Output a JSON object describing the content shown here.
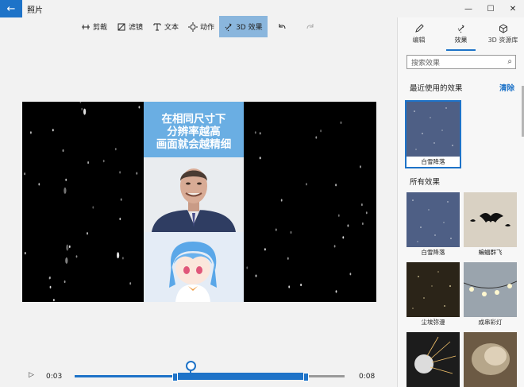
{
  "window": {
    "title": "照片",
    "minimize": "—",
    "maximize": "☐",
    "close": "✕"
  },
  "toolbar": {
    "items": [
      {
        "label": "剪裁",
        "icon": "trim-icon"
      },
      {
        "label": "滤镜",
        "icon": "filter-icon"
      },
      {
        "label": "文本",
        "icon": "text-icon"
      },
      {
        "label": "动作",
        "icon": "motion-icon"
      },
      {
        "label": "3D 效果",
        "icon": "3d-effects-icon",
        "active": true
      }
    ],
    "undo_icon": "undo-icon",
    "redo_icon": "redo-icon"
  },
  "preview": {
    "caption_lines": [
      "在相同尺寸下",
      "分辨率越高",
      "画面就会越精细"
    ]
  },
  "timeline": {
    "current_time": "0:03",
    "end_time": "0:08",
    "playhead_fraction": 0.43,
    "range_start_fraction": 0.37,
    "range_end_fraction": 0.86
  },
  "panel": {
    "tabs": [
      {
        "label": "编辑",
        "icon": "pencil-icon"
      },
      {
        "label": "效果",
        "icon": "effects-icon",
        "active": true
      },
      {
        "label": "3D 资源库",
        "icon": "cube-icon"
      }
    ],
    "search_placeholder": "搜索效果",
    "recent_title": "最近使用的效果",
    "clear_label": "清除",
    "all_title": "所有效果",
    "recent": [
      {
        "label": "白雪降落"
      }
    ],
    "effects": [
      {
        "label": "白雪降落"
      },
      {
        "label": "蝙蝠群飞"
      },
      {
        "label": "尘埃弥漫"
      },
      {
        "label": "成串彩灯"
      },
      {
        "label": ""
      },
      {
        "label": ""
      }
    ]
  },
  "colors": {
    "accent": "#1e73c8",
    "active_tool": "#8ab6dd",
    "caption_bg": "#6aaee3"
  }
}
